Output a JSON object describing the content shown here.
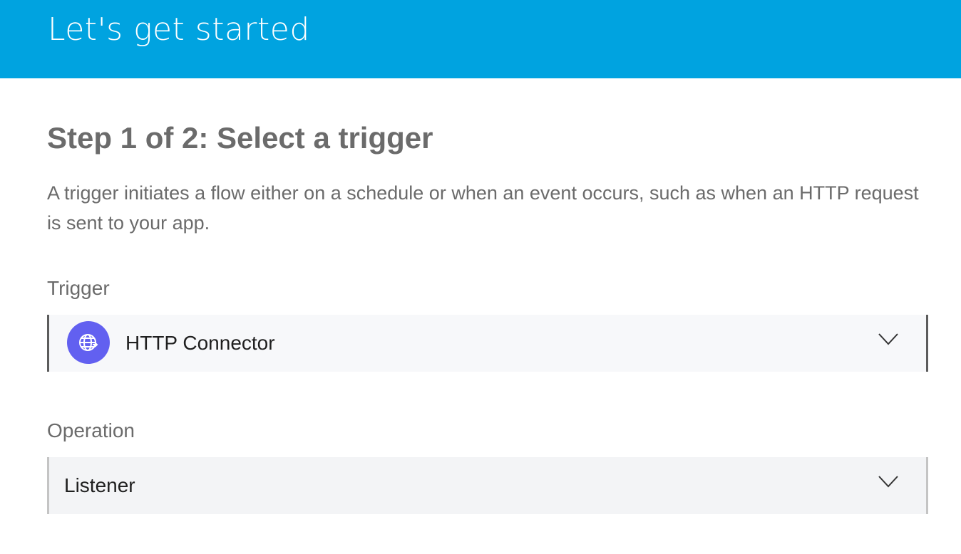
{
  "header": {
    "title": "Let's get started"
  },
  "step": {
    "title": "Step 1 of 2: Select a trigger",
    "description": "A trigger initiates a flow either on a schedule or when an event occurs, such as when an HTTP request is sent to your app."
  },
  "trigger_field": {
    "label": "Trigger",
    "value": "HTTP Connector",
    "icon": "globe-icon",
    "icon_color": "#6260f0"
  },
  "operation_field": {
    "label": "Operation",
    "value": "Listener"
  },
  "colors": {
    "header_background": "#00a3e0",
    "text_muted": "#6b6b6b"
  }
}
